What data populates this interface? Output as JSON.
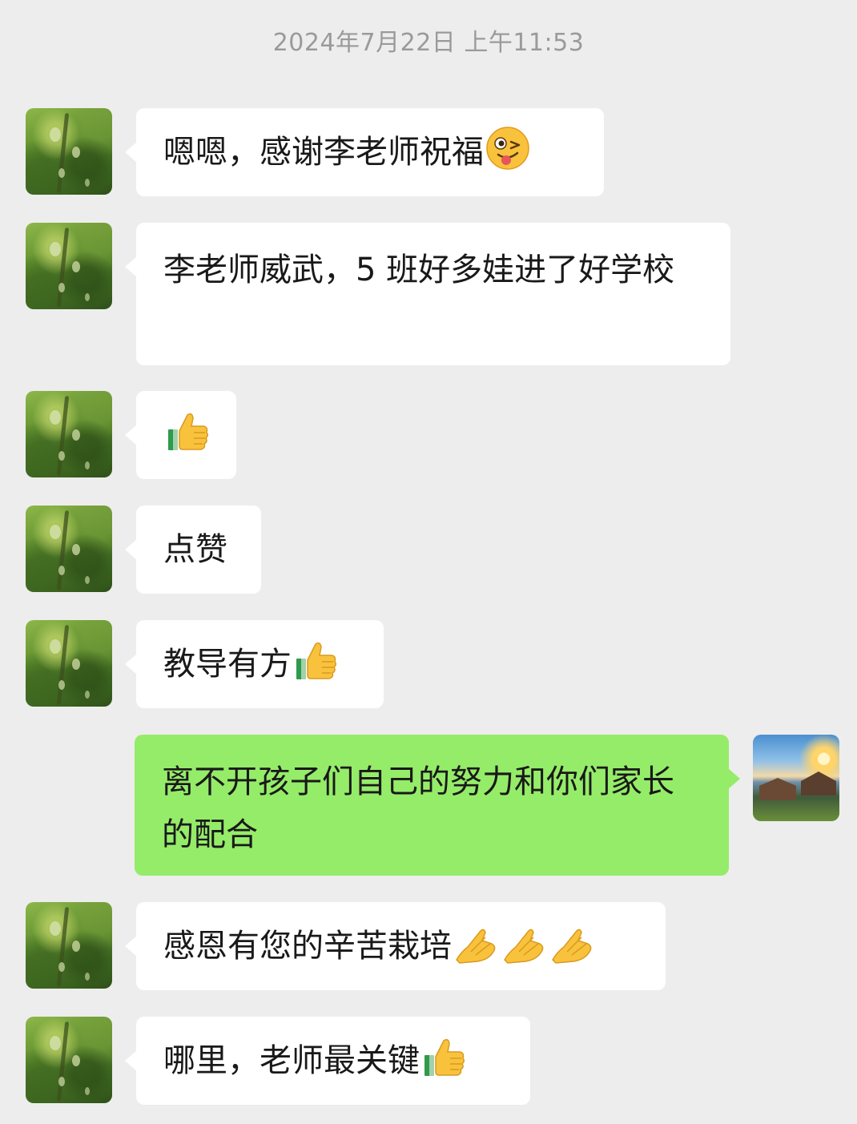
{
  "timestamp": "2024年7月22日 上午11:53",
  "messages": [
    {
      "sender": "other",
      "text": "嗯嗯，感谢李老师祝福",
      "emojis": [
        "winking-tongue-face"
      ]
    },
    {
      "sender": "other",
      "text": "李老师威武，5 班好多娃进了好学校",
      "emojis": []
    },
    {
      "sender": "other",
      "text": "",
      "emojis": [
        "thumbs-up"
      ]
    },
    {
      "sender": "other",
      "text": "点赞",
      "emojis": []
    },
    {
      "sender": "other",
      "text": "教导有方",
      "emojis": [
        "thumbs-up"
      ]
    },
    {
      "sender": "self",
      "text": "离不开孩子们自己的努力和你们家长的配合",
      "emojis": []
    },
    {
      "sender": "other",
      "text": "感恩有您的辛苦栽培",
      "emojis": [
        "folded-hands",
        "folded-hands",
        "folded-hands"
      ]
    },
    {
      "sender": "other",
      "text": "哪里，老师最关键",
      "emojis": [
        "thumbs-up"
      ]
    }
  ],
  "colors": {
    "background": "#ededed",
    "incoming_bubble": "#ffffff",
    "outgoing_bubble": "#95ec69",
    "timestamp_text": "#9a9a9a"
  }
}
